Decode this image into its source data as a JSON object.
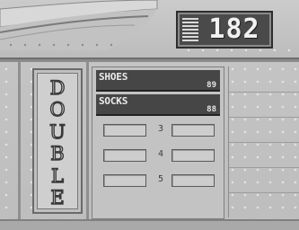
{
  "counter": {
    "value": "182"
  },
  "double_panel": {
    "letters": [
      "D",
      "O",
      "U",
      "B",
      "L",
      "E"
    ]
  },
  "bars": [
    {
      "label": "SHOES",
      "value": "89"
    },
    {
      "label": "SOCKS",
      "value": "88"
    }
  ],
  "slots": [
    {
      "number": "3",
      "marker": ""
    },
    {
      "number": "4",
      "marker": "»"
    },
    {
      "number": "5",
      "marker": ""
    }
  ],
  "colors": {
    "background": "#b4b4b4",
    "bar_fill": "#464646",
    "counter_fill": "#4a4a4a",
    "text_light": "#ececec",
    "text_dark": "#3f3f3f"
  },
  "icons": {
    "counter_grip": "striped-grip-icon"
  }
}
